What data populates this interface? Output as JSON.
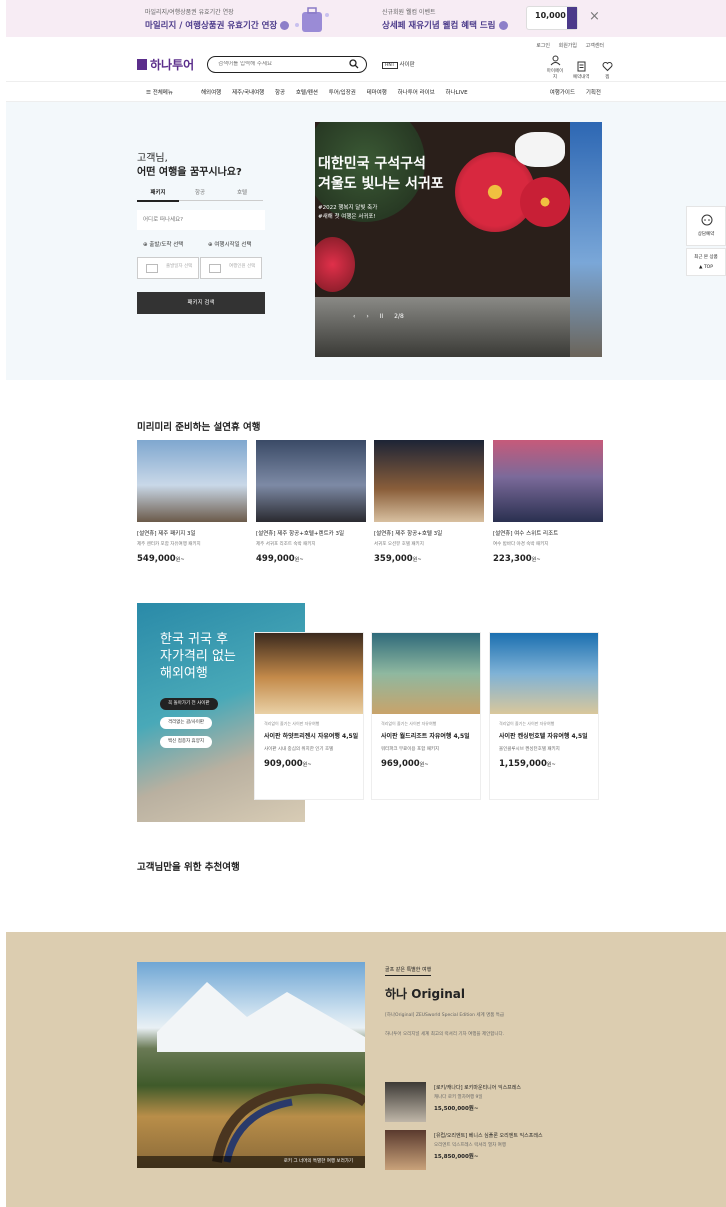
{
  "promo": {
    "left_small": "마일리지/여행상품권 유효기간 연장",
    "left_big": "마일리지 / 여행상품권 유효기간 연장",
    "right_small": "신규회원 웰컴 이벤트",
    "right_big": "상세페 재유기념 웰컴 혜택 드림",
    "coupon_value": "10,000",
    "close_label": "×"
  },
  "header": {
    "util_links": [
      "로그인",
      "회원가입",
      "고객센터"
    ],
    "logo_text": "하나투어",
    "search_placeholder": "검색어를 입력해 주세요",
    "hnt_badge": "HNT",
    "hnt_label": "사이판",
    "icons": [
      {
        "name": "mypage-icon",
        "label": "마이페이지"
      },
      {
        "name": "reservation-icon",
        "label": "예약내역"
      },
      {
        "name": "wishlist-icon",
        "label": "찜"
      }
    ]
  },
  "nav": {
    "all_menu": "전체메뉴",
    "items": [
      "해외여행",
      "제주/국내여행",
      "항공",
      "호텔/펜션",
      "투어/입장권",
      "테마여행",
      "하나투어 라이브",
      "하나LIVE"
    ],
    "right": [
      "여행가이드",
      "기획전"
    ]
  },
  "hero": {
    "greet_line1": "고객님,",
    "greet_line2": "어떤 여행을 꿈꾸시나요?",
    "search_tabs": [
      "패키지",
      "항공",
      "호텔"
    ],
    "destination_placeholder": "어디로 떠나세요?",
    "option1": "출발/도착 선택",
    "option2": "여행시작일 선택",
    "box1": "출발일자 선택",
    "box2": "여행인원 선택",
    "search_button": "패키지 검색",
    "slide_title_line1": "대한민국 구석구석",
    "slide_title_line2": "겨울도 빛나는 서귀포",
    "slide_sub_line1": "#2022 행복지 달빛 축가",
    "slide_sub_line2": "#새해 첫 여행은 서귀포!",
    "slide_controls": [
      "‹",
      "›",
      "II",
      "2/8"
    ],
    "quick_consult": "상담예약",
    "quick_recent": "최근 본 상품",
    "quick_top": "TOP"
  },
  "section1": {
    "title": "미리미리 준비하는 설연휴 여행",
    "cards": [
      {
        "title": "[설연휴] 제주 패키지 3일",
        "desc": "제주 렌터카 포함 자유여행 패키지",
        "price": "549,000",
        "unit": "원~",
        "colors": [
          "#7fa7cf",
          "#c9d8e8",
          "#6b5a4a"
        ]
      },
      {
        "title": "[설연휴] 제주 항공+호텔+렌트카 3일",
        "desc": "제주 서귀포 리조트 숙박 패키지",
        "price": "499,000",
        "unit": "원~",
        "colors": [
          "#3a4a66",
          "#7d8aa5",
          "#2a2a30"
        ]
      },
      {
        "title": "[설연휴] 제주 항공+호텔 3일",
        "desc": "서귀포 오션뷰 호텔 패키지",
        "price": "359,000",
        "unit": "원~",
        "colors": [
          "#1d2436",
          "#8a5e3a",
          "#d8c0a0"
        ]
      },
      {
        "title": "[설연휴] 여수 스위트 리조트",
        "desc": "여수 밤바다 야경 숙박 패키지",
        "price": "223,300",
        "unit": "원~",
        "colors": [
          "#c65a7a",
          "#7b6a9a",
          "#2a3050"
        ]
      }
    ]
  },
  "section2": {
    "banner_title_line1": "한국 귀국 후",
    "banner_title_line2": "자가격리 없는",
    "banner_title_line3": "해외여행",
    "pills": [
      "꼭 돌아가기 전 사이판",
      "격리없는 괌/사이판",
      "백신 접종자 휴양지"
    ],
    "cards": [
      {
        "tag": "격리없이 즐기는 사이판 자유여행",
        "title": "사이판 하얏트리젠시 자유여행 4,5일",
        "desc": "사이판 시내 중심의 위치한 인기 호텔",
        "price": "909,000",
        "unit": "원~",
        "colors": [
          "#3b2a1e",
          "#c48a4a",
          "#e9d1a6"
        ]
      },
      {
        "tag": "격리없이 즐기는 사이판 자유여행",
        "title": "사이판 월드리조트 자유여행 4,5일",
        "desc": "워터파크 무료이용 포함 패키지",
        "price": "969,000",
        "unit": "원~",
        "colors": [
          "#2f6a7a",
          "#8fb8a0",
          "#c9a36a"
        ]
      },
      {
        "tag": "격리없이 즐기는 사이판 자유여행",
        "title": "사이판 켄싱턴호텔 자유여행 4,5일",
        "desc": "올인클루시브 켄싱턴호텔 패키지",
        "price": "1,159,000",
        "unit": "원~",
        "colors": [
          "#1b6fb0",
          "#7fb2d6",
          "#d9c79b"
        ]
      }
    ]
  },
  "section3": {
    "title": "고객님만을 위한 추천여행"
  },
  "original": {
    "eyebrow": "골프 같은 특별한 여행",
    "title": "하나 Original",
    "desc1": "[하나Original] ZEUSworld Special Edition 세계 명품 특급",
    "desc2": "하나투어 오리지널 세계 최고의 럭셔리 기차 여행을 제안합니다.",
    "photo_caption": "로키 그 너머의 특별한 여행 보러가기",
    "items": [
      {
        "title": "[로키/캐나다] 로키마운티니어 익스프레스",
        "desc": "캐나다 로키 열차여행 9일",
        "price": "15,500,000원~",
        "colors": [
          "#3d3a36",
          "#bfb6a8"
        ]
      },
      {
        "title": "[유럽/오리엔트] 베니스 심플론 오리엔트 익스프레스",
        "desc": "오리엔트 익스프레스 럭셔리 열차 여행",
        "price": "15,850,000원~",
        "colors": [
          "#5a3a2e",
          "#c9a27a"
        ]
      }
    ]
  }
}
